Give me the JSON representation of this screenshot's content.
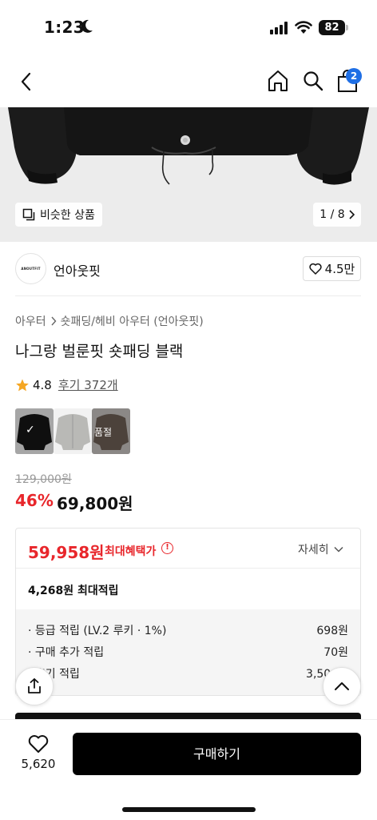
{
  "status_bar": {
    "time": "1:23",
    "battery": "82"
  },
  "nav": {
    "cart_count": "2"
  },
  "gallery": {
    "similar_label": "비슷한 상품",
    "page_indicator": "1 / 8"
  },
  "brand": {
    "logo_text": "ANOUTFIT",
    "name": "언아웃핏",
    "likes": "4.5만"
  },
  "product": {
    "breadcrumb": [
      "아우터",
      "숏패딩/헤비 아우터 (언아웃핏)"
    ],
    "title": "나그랑 벌룬핏 숏패딩 블랙",
    "rating": "4.8",
    "review_label": "후기 372개",
    "swatches": [
      {
        "name": "black",
        "selected": true
      },
      {
        "name": "gray",
        "selected": false
      },
      {
        "name": "brown",
        "selected": false,
        "label": "품절"
      }
    ],
    "original_price": "129,000원",
    "discount_rate": "46%",
    "sale_price": "69,800원"
  },
  "benefit": {
    "best_price": "59,958원",
    "best_label": "최대혜택가",
    "detail_label": "자세히",
    "points_summary": "4,268원 최대적립",
    "rows": [
      {
        "label": "· 등급 적립 (LV.2 루키 · 1%)",
        "value": "698원"
      },
      {
        "label": "· 구매 추가 적립",
        "value": "70원"
      },
      {
        "label": "· 후기 적립",
        "value": "3,500원"
      }
    ]
  },
  "bottom": {
    "wish_count": "5,620",
    "buy_label": "구매하기"
  },
  "colors": {
    "accent_red": "#e8262b",
    "badge_blue": "#1f6fe5",
    "star": "#f5a623"
  }
}
